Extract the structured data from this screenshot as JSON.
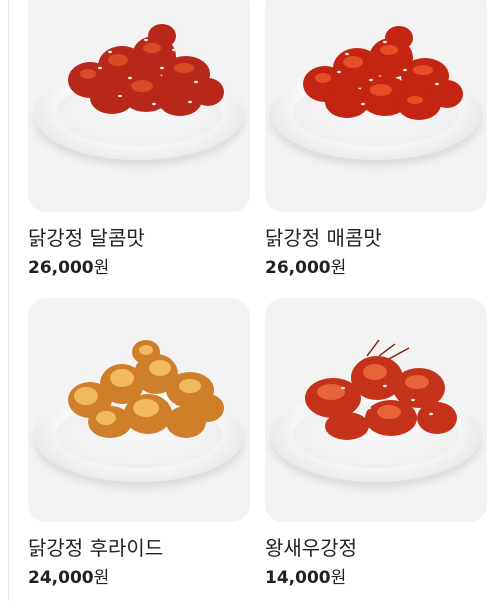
{
  "menu": {
    "items": [
      {
        "name": "닭강정 달콤맛",
        "price": "26,000",
        "currency": "원",
        "sauce_color": "#c0301b",
        "highlight_color": "#e2572b",
        "image_icon": "sweet-chicken-photo"
      },
      {
        "name": "닭강정 매콤맛",
        "price": "26,000",
        "currency": "원",
        "sauce_color": "#cc2a12",
        "highlight_color": "#ea4a22",
        "image_icon": "spicy-chicken-photo"
      },
      {
        "name": "닭강정 후라이드",
        "price": "24,000",
        "currency": "원",
        "sauce_color": "#d9892e",
        "highlight_color": "#f2bd62",
        "image_icon": "fried-chicken-photo"
      },
      {
        "name": "왕새우강정",
        "price": "14,000",
        "currency": "원",
        "sauce_color": "#c4321a",
        "highlight_color": "#ee6a3a",
        "image_icon": "shrimp-photo"
      }
    ]
  }
}
